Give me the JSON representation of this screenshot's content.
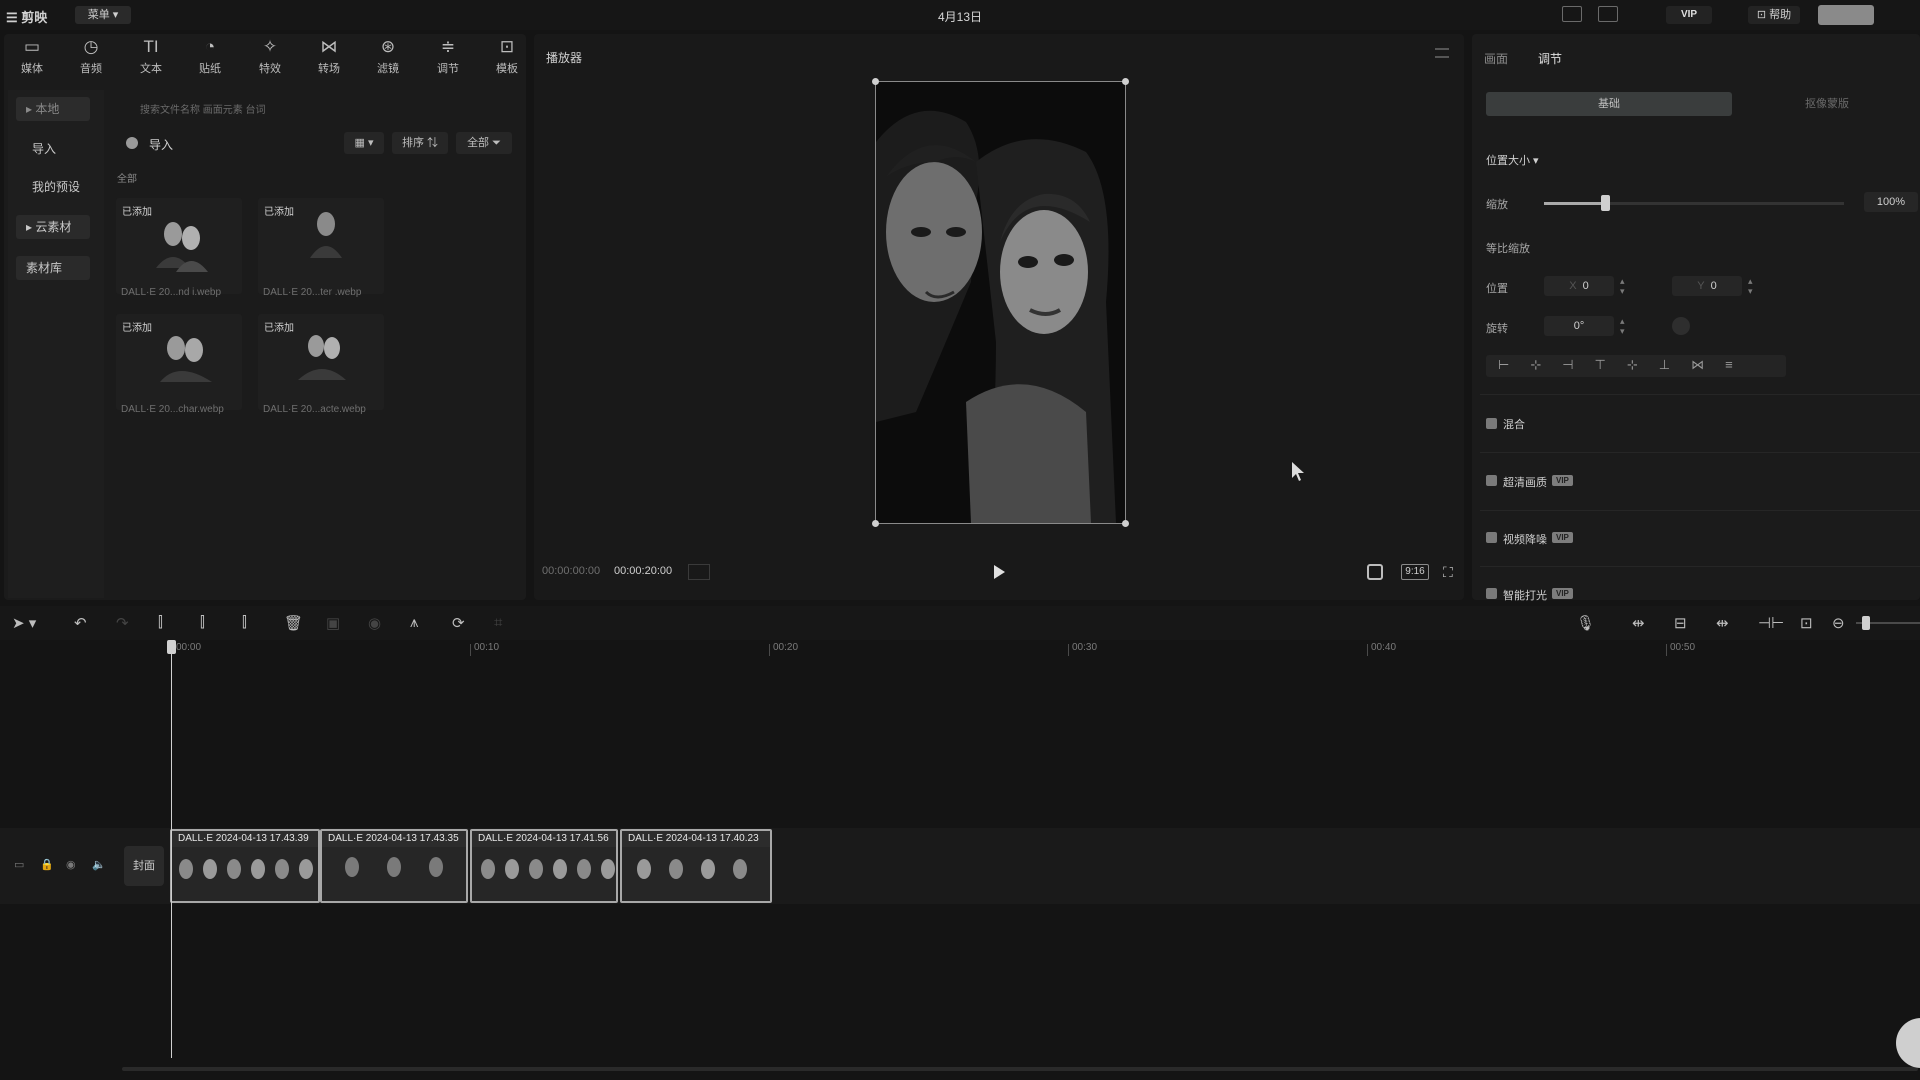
{
  "topbar": {
    "logo": "剪映",
    "menu_label": "菜单",
    "title": "4月13日",
    "vip_label": "VIP",
    "share_label": "帮助"
  },
  "media_tools": [
    {
      "icon": "media-icon",
      "glyph": "▭",
      "label": "媒体"
    },
    {
      "icon": "audio-icon",
      "glyph": "◷",
      "label": "音频"
    },
    {
      "icon": "text-icon",
      "glyph": "TI",
      "label": "文本"
    },
    {
      "icon": "sticker-icon",
      "glyph": "◔",
      "label": "贴纸"
    },
    {
      "icon": "effects-icon",
      "glyph": "✧",
      "label": "特效"
    },
    {
      "icon": "transition-icon",
      "glyph": "⋈",
      "label": "转场"
    },
    {
      "icon": "filter-icon",
      "glyph": "⊛",
      "label": "滤镜"
    },
    {
      "icon": "adjust-icon",
      "glyph": "≑",
      "label": "调节"
    },
    {
      "icon": "template-icon",
      "glyph": "⊡",
      "label": "模板"
    }
  ],
  "media_sidebar": {
    "items": [
      "本地",
      "导入",
      "我的预设",
      "云素材",
      "素材库"
    ]
  },
  "media": {
    "search_hint": "搜索文件名称    画面元素    台词",
    "import_label": "导入",
    "sort_label": "排序",
    "filter_label": "全部",
    "section_label": "全部",
    "added_badge": "已添加",
    "items": [
      {
        "name": "DALL·E 20...nd i.webp"
      },
      {
        "name": "DALL·E 20...ter .webp"
      },
      {
        "name": "DALL·E 20...char.webp"
      },
      {
        "name": "DALL·E 20...acte.webp"
      }
    ]
  },
  "player": {
    "title": "播放器",
    "time_current": "00:00:00:00",
    "time_total": "00:00:20:00",
    "ratio": "9:16"
  },
  "properties": {
    "tabs": [
      "画面",
      "调节"
    ],
    "segments": [
      "基础",
      "抠像蒙版"
    ],
    "section_position": "位置大小",
    "scale_label": "缩放",
    "scale_value": "100%",
    "scale_level": 0.18,
    "uniform_scale_label": "等比缩放",
    "position_label": "位置",
    "x_value": "0",
    "y_value": "0",
    "rotate_label": "旋转",
    "rotate_value": "0°",
    "blend_label": "混合",
    "super_res_label": "超清画质",
    "denoise_label": "视频降噪",
    "flicker_label": "智能打光",
    "vip_tag": "VIP"
  },
  "timeline": {
    "ticks": [
      "00:00",
      "00:10",
      "00:20",
      "00:30",
      "00:40",
      "00:50"
    ],
    "cover_label": "封面",
    "clips": [
      {
        "label": "DALL·E 2024-04-13 17.43.39"
      },
      {
        "label": "DALL·E 2024-04-13 17.43.35"
      },
      {
        "label": "DALL·E 2024-04-13 17.41.56"
      },
      {
        "label": "DALL·E 2024-04-13 17.40.23"
      }
    ]
  },
  "colors": {
    "background": "#141414",
    "panel": "#1b1b1b",
    "accent": "#cfcfcf"
  }
}
